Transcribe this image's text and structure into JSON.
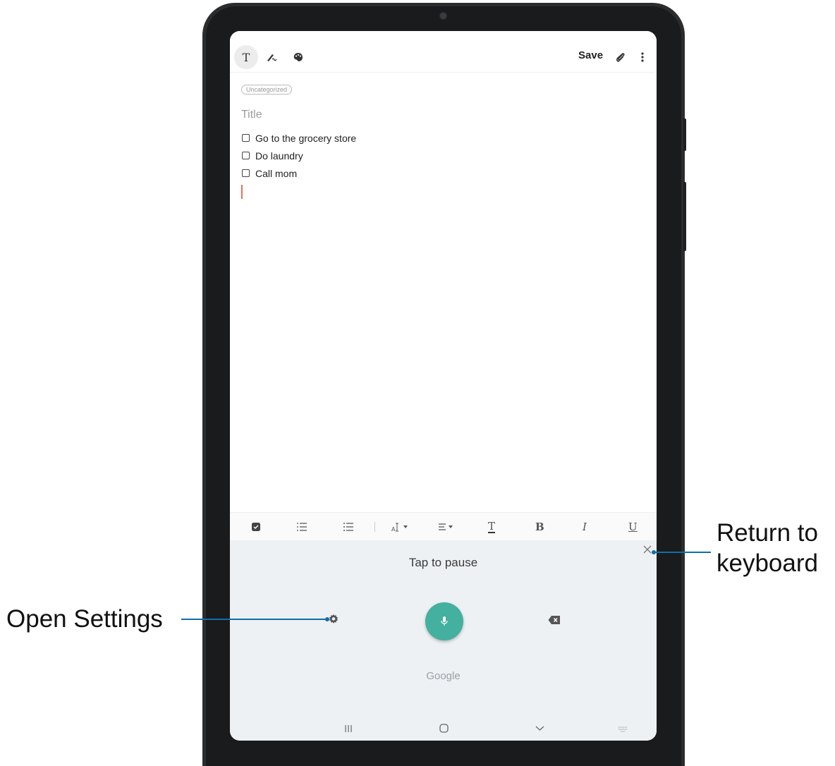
{
  "toolbar": {
    "mode_text_icon": "T",
    "save_label": "Save"
  },
  "note": {
    "category": "Uncategorized",
    "title_placeholder": "Title",
    "items": [
      "Go to the grocery store",
      "Do laundry",
      "Call mom"
    ]
  },
  "format_bar": {
    "bold": "B",
    "italic": "I",
    "underline": "U",
    "text_color": "T"
  },
  "voice_panel": {
    "status": "Tap to pause",
    "engine": "Google",
    "mic_color": "#43b0a0"
  },
  "callouts": {
    "left": "Open Settings",
    "right_line1": "Return to",
    "right_line2": "keyboard",
    "line_color": "#0f6fa8"
  }
}
